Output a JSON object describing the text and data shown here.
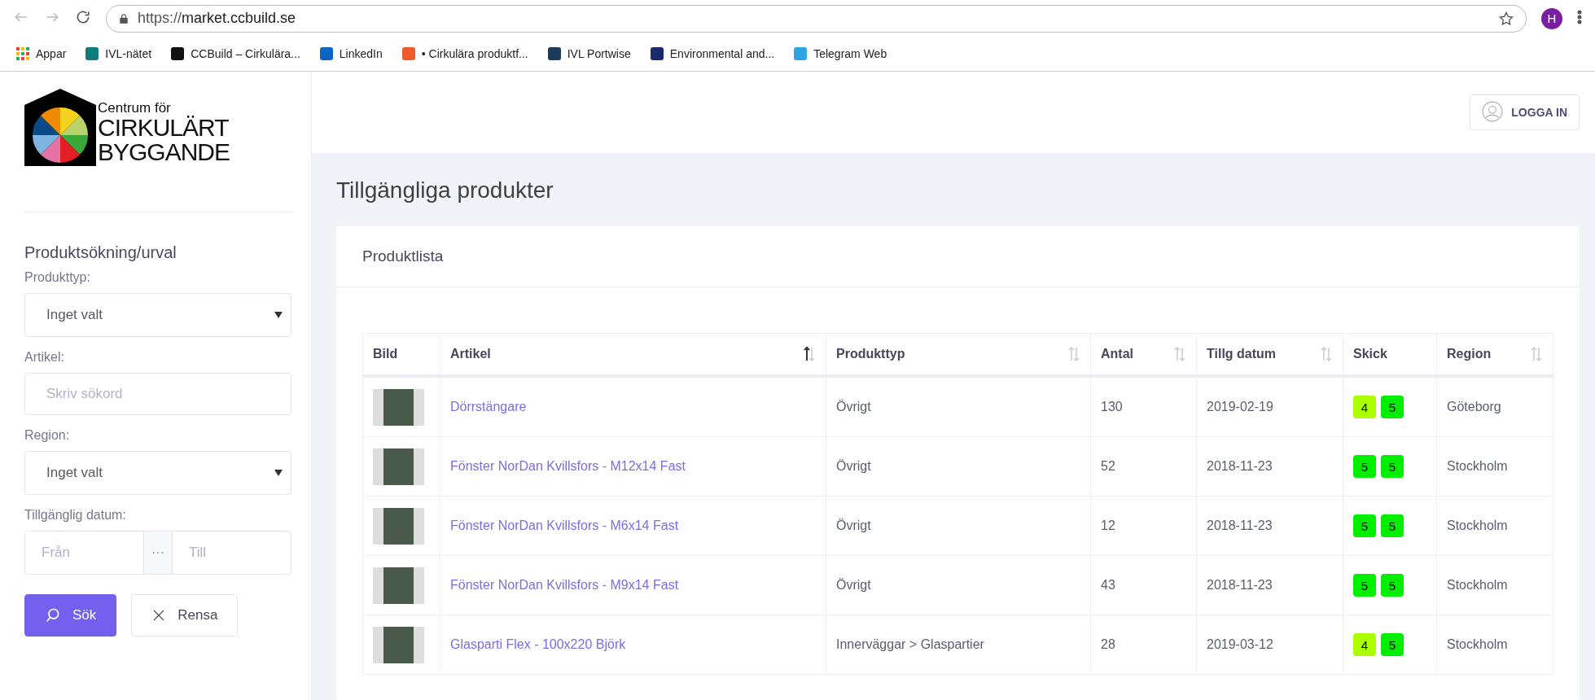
{
  "browser": {
    "url_prefix": "https://",
    "url_domain": "market.ccbuild.se",
    "profile_initial": "H"
  },
  "bookmarks": [
    {
      "label": "Appar",
      "kind": "apps"
    },
    {
      "label": "IVL-nätet",
      "kind": "favicon",
      "color": "#0f7b7b"
    },
    {
      "label": "CCBuild – Cirkulära...",
      "kind": "favicon",
      "color": "#111111"
    },
    {
      "label": "LinkedIn",
      "kind": "favicon",
      "color": "#0a66c2"
    },
    {
      "label": "• Cirkulära produktf...",
      "kind": "favicon",
      "color": "#f05a28"
    },
    {
      "label": "IVL Portwise",
      "kind": "favicon",
      "color": "#1b3a5c"
    },
    {
      "label": "Environmental and...",
      "kind": "favicon",
      "color": "#1a2a6c"
    },
    {
      "label": "Telegram Web",
      "kind": "favicon",
      "color": "#2ca5e0"
    }
  ],
  "logo": {
    "line_1": "Centrum för",
    "line_2": "CIRKULÄRT",
    "line_3": "BYGGANDE"
  },
  "sidebar": {
    "title": "Produktsökning/urval",
    "fields": [
      {
        "kind": "select",
        "label": "Produkttyp:",
        "value": "Inget valt"
      },
      {
        "kind": "text",
        "label": "Artikel:",
        "placeholder": "Skriv sökord"
      },
      {
        "kind": "select",
        "label": "Region:",
        "value": "Inget valt"
      },
      {
        "kind": "range",
        "label": "Tillgänglig datum:",
        "from_placeholder": "Från",
        "separator": "···",
        "to_placeholder": "Till"
      }
    ],
    "buttons": [
      {
        "label": "Sök",
        "kind": "primary"
      },
      {
        "label": "Rensa",
        "kind": "secondary"
      }
    ]
  },
  "header": {
    "login_button": "LOGGA IN"
  },
  "page_title": "Tillgängliga produkter",
  "card": {
    "title": "Produktlista",
    "table": {
      "columns": [
        {
          "label": "Bild",
          "sortable": false,
          "sorted": false
        },
        {
          "label": "Artikel",
          "sortable": true,
          "sorted": true
        },
        {
          "label": "Produkttyp",
          "sortable": true,
          "sorted": false
        },
        {
          "label": "Antal",
          "sortable": true,
          "sorted": false
        },
        {
          "label": "Tillg datum",
          "sortable": true,
          "sorted": false
        },
        {
          "label": "Skick",
          "sortable": false,
          "sorted": false
        },
        {
          "label": "Region",
          "sortable": true,
          "sorted": false
        }
      ],
      "rows": [
        {
          "article": "Dörrstängare",
          "type": "Övrigt",
          "count": "130",
          "date": "2019-02-19",
          "condition": [
            {
              "value": "4",
              "color": "#aaff00"
            },
            {
              "value": "5",
              "color": "#00ee00"
            }
          ],
          "region": "Göteborg"
        },
        {
          "article": "Fönster NorDan Kvillsfors - M12x14 Fast",
          "type": "Övrigt",
          "count": "52",
          "date": "2018-11-23",
          "condition": [
            {
              "value": "5",
              "color": "#00ee00"
            },
            {
              "value": "5",
              "color": "#00ee00"
            }
          ],
          "region": "Stockholm"
        },
        {
          "article": "Fönster NorDan Kvillsfors - M6x14 Fast",
          "type": "Övrigt",
          "count": "12",
          "date": "2018-11-23",
          "condition": [
            {
              "value": "5",
              "color": "#00ee00"
            },
            {
              "value": "5",
              "color": "#00ee00"
            }
          ],
          "region": "Stockholm"
        },
        {
          "article": "Fönster NorDan Kvillsfors - M9x14 Fast",
          "type": "Övrigt",
          "count": "43",
          "date": "2018-11-23",
          "condition": [
            {
              "value": "5",
              "color": "#00ee00"
            },
            {
              "value": "5",
              "color": "#00ee00"
            }
          ],
          "region": "Stockholm"
        },
        {
          "article": "Glasparti Flex - 100x220 Björk",
          "type": "Innerväggar > Glaspartier",
          "count": "28",
          "date": "2019-03-12",
          "condition": [
            {
              "value": "4",
              "color": "#aaff00"
            },
            {
              "value": "5",
              "color": "#00ee00"
            }
          ],
          "region": "Stockholm"
        }
      ]
    }
  }
}
